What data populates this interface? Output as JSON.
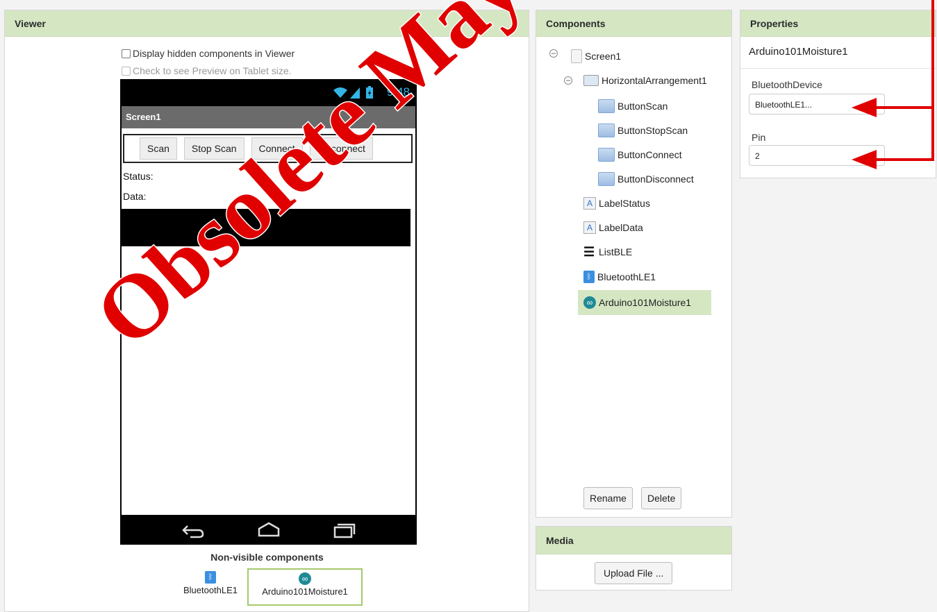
{
  "viewer": {
    "title": "Viewer",
    "display_hidden_label": "Display hidden components in Viewer",
    "tablet_preview_label": "Check to see Preview on Tablet size.",
    "phone": {
      "time": "9:48",
      "screen_title": "Screen1",
      "buttons": [
        "Scan",
        "Stop Scan",
        "Connect",
        "Disconnect"
      ],
      "status_label": "Status:",
      "data_label": "Data:"
    },
    "nonvisible_title": "Non-visible components",
    "nonvisible": [
      {
        "label": "BluetoothLE1",
        "icon": "bluetooth-icon"
      },
      {
        "label": "Arduino101Moisture1",
        "icon": "arduino-icon"
      }
    ]
  },
  "components": {
    "title": "Components",
    "tree": [
      {
        "label": "Screen1",
        "icon": "screen-icon"
      },
      {
        "label": "HorizontalArrangement1",
        "icon": "horizontal-arrangement-icon"
      },
      {
        "label": "ButtonScan",
        "icon": "button-icon"
      },
      {
        "label": "ButtonStopScan",
        "icon": "button-icon"
      },
      {
        "label": "ButtonConnect",
        "icon": "button-icon"
      },
      {
        "label": "ButtonDisconnect",
        "icon": "button-icon"
      },
      {
        "label": "LabelStatus",
        "icon": "label-icon"
      },
      {
        "label": "LabelData",
        "icon": "label-icon"
      },
      {
        "label": "ListBLE",
        "icon": "listview-icon"
      },
      {
        "label": "BluetoothLE1",
        "icon": "bluetooth-icon"
      },
      {
        "label": "Arduino101Moisture1",
        "icon": "arduino-icon"
      }
    ],
    "rename_label": "Rename",
    "delete_label": "Delete"
  },
  "media": {
    "title": "Media",
    "upload_label": "Upload File ..."
  },
  "properties": {
    "title": "Properties",
    "component_name": "Arduino101Moisture1",
    "bluetooth_device_label": "BluetoothDevice",
    "bluetooth_device_value": "BluetoothLE1...",
    "pin_label": "Pin",
    "pin_value": "2"
  },
  "watermark": "Obsolete May Not",
  "colors": {
    "panel_header": "#d5e6c3",
    "selected_row": "#d5e6c3",
    "arrow": "#e00000",
    "status_blue": "#33b5e5"
  }
}
